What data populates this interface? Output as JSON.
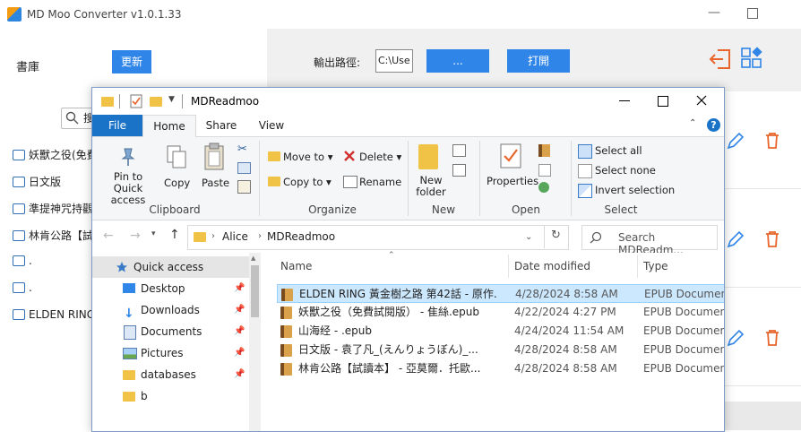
{
  "app": {
    "title": "MD Moo Converter v1.0.1.33",
    "library_label": "書庫",
    "update_label": "更新",
    "output_path_label": "輸出路徑:",
    "output_path_value": "C:\\Use",
    "browse_label": "...",
    "open_label": "打開",
    "books": [
      "妖獸之役(免費",
      "日文版",
      "準提神咒持觀",
      "林肯公路【試讀",
      ".",
      ".",
      "ELDEN RING"
    ],
    "search_glyph": "搜"
  },
  "explorer": {
    "title": "MDReadmoo",
    "tabs": {
      "file": "File",
      "home": "Home",
      "share": "Share",
      "view": "View"
    },
    "ribbon": {
      "clipboard": {
        "label": "Clipboard",
        "pin": "Pin to Quick access",
        "copy": "Copy",
        "paste": "Paste"
      },
      "organize": {
        "label": "Organize",
        "move_to": "Move to",
        "copy_to": "Copy to",
        "delete": "Delete",
        "rename": "Rename"
      },
      "new": {
        "label": "New",
        "new_folder": "New folder"
      },
      "open": {
        "label": "Open",
        "properties": "Properties"
      },
      "select": {
        "label": "Select",
        "select_all": "Select all",
        "select_none": "Select none",
        "invert": "Invert selection"
      }
    },
    "address": {
      "crumbs": [
        "Alice",
        "MDReadmoo"
      ],
      "search_placeholder": "Search MDReadm..."
    },
    "nav": [
      {
        "label": "Quick access",
        "pinned": false
      },
      {
        "label": "Desktop",
        "pinned": true
      },
      {
        "label": "Downloads",
        "pinned": true
      },
      {
        "label": "Documents",
        "pinned": true
      },
      {
        "label": "Pictures",
        "pinned": true
      },
      {
        "label": "databases",
        "pinned": true
      },
      {
        "label": "b",
        "pinned": false
      }
    ],
    "columns": {
      "name": "Name",
      "date": "Date modified",
      "type": "Type"
    },
    "files": [
      {
        "name": "ELDEN RING 黃金樹之路 第42話 - 原作...",
        "date": "4/28/2024 8:58 AM",
        "type": "EPUB Document"
      },
      {
        "name": "妖獸之役（免費試閱版） - 隹絲.epub",
        "date": "4/22/2024 4:27 PM",
        "type": "EPUB Document"
      },
      {
        "name": "山海经 - .epub",
        "date": "4/24/2024 11:54 AM",
        "type": "EPUB Document"
      },
      {
        "name": "日文版 - 袁了凡_(えんりょうぼん)_...",
        "date": "4/28/2024 8:58 AM",
        "type": "EPUB Document"
      },
      {
        "name": "林肯公路【試讀本】 - 亞莫爾．托歐...",
        "date": "4/28/2024 8:58 AM",
        "type": "EPUB Document"
      }
    ]
  }
}
